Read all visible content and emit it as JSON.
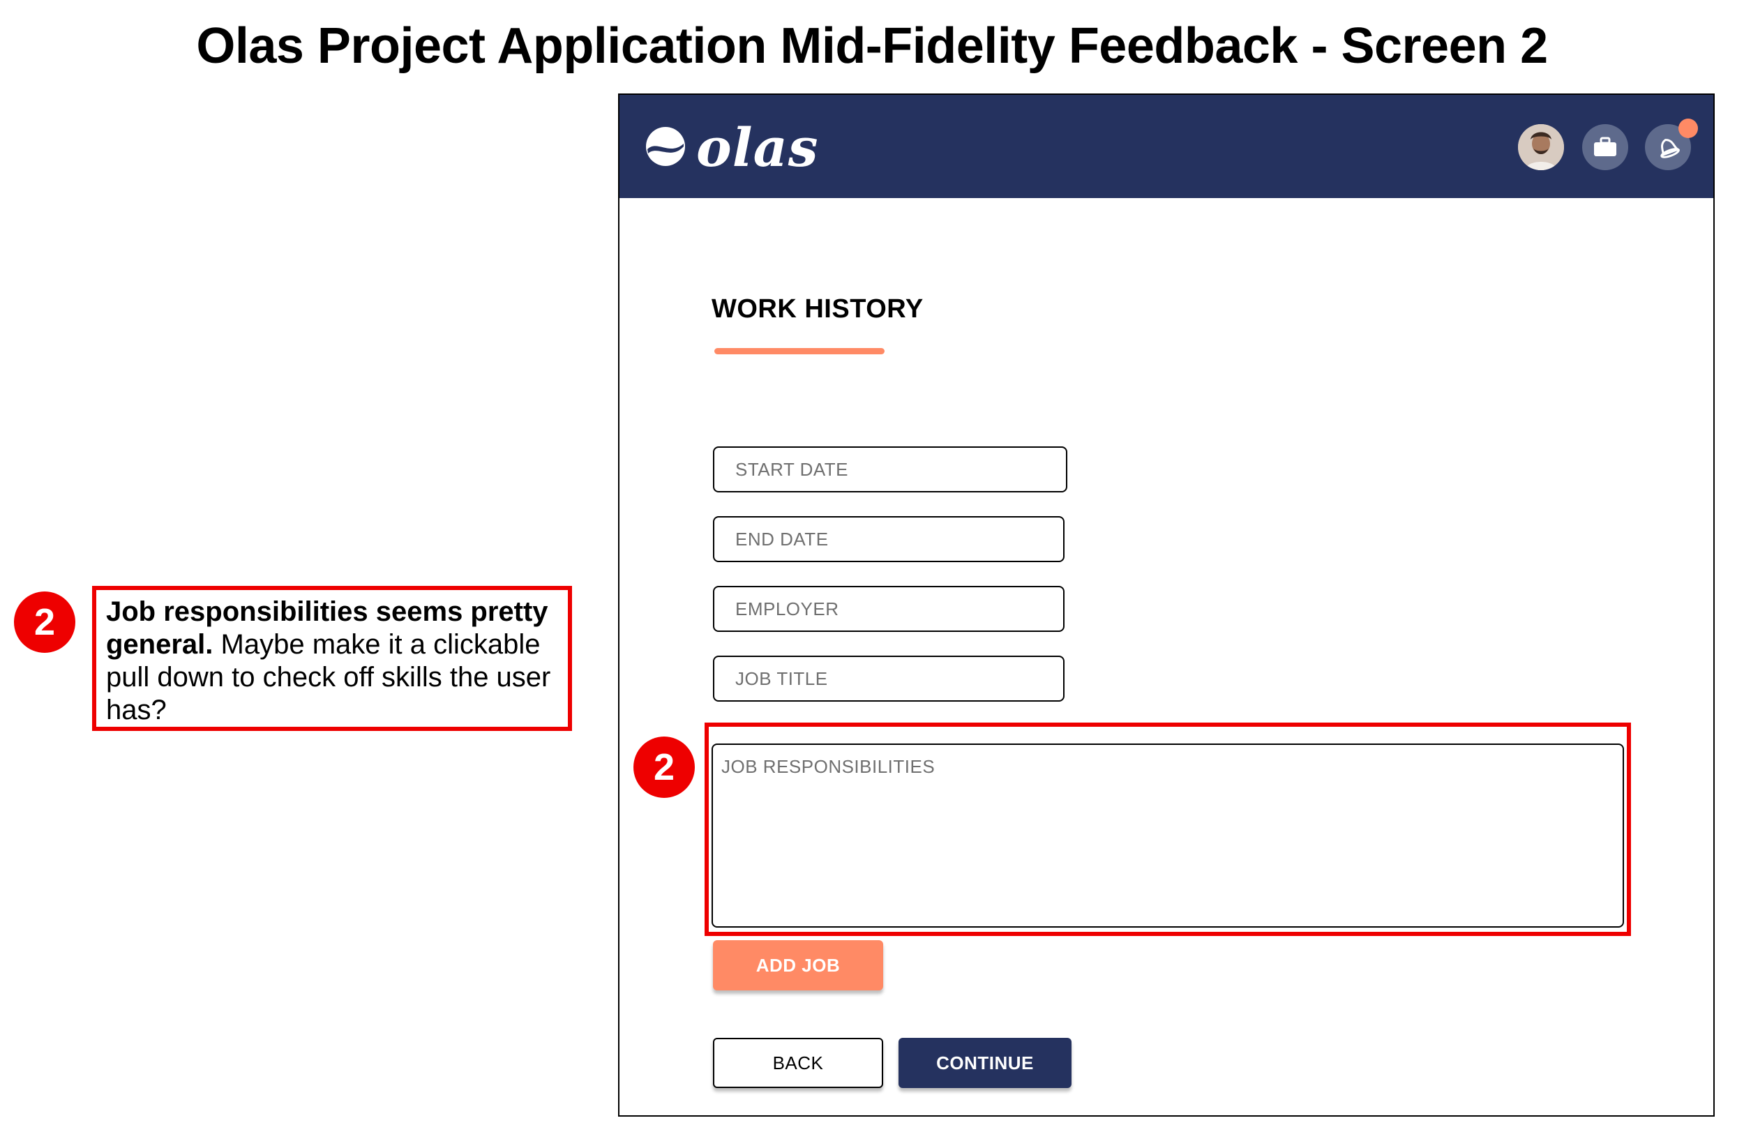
{
  "page_title": "Olas Project Application Mid-Fidelity Feedback - Screen 2",
  "annotation": {
    "number": "2",
    "bold_text": "Job responsibilities seems pretty general.",
    "text": " Maybe make it a clickable pull down to check off skills the user has?"
  },
  "app": {
    "logo_text": "olas",
    "header_icons": [
      "user-avatar",
      "briefcase-icon",
      "bell-icon"
    ],
    "section_title": "WORK HISTORY",
    "fields": {
      "start_date_placeholder": "START DATE",
      "end_date_placeholder": "END DATE",
      "employer_placeholder": "EMPLOYER",
      "job_title_placeholder": "JOB TITLE",
      "job_responsibilities_placeholder": "JOB RESPONSIBILITIES"
    },
    "marker_number": "2",
    "buttons": {
      "add_job": "ADD JOB",
      "back": "BACK",
      "continue": "CONTINUE"
    }
  },
  "colors": {
    "header_navy": "#25325f",
    "accent_orange": "#ff8a65",
    "annotation_red": "#ee0000"
  }
}
